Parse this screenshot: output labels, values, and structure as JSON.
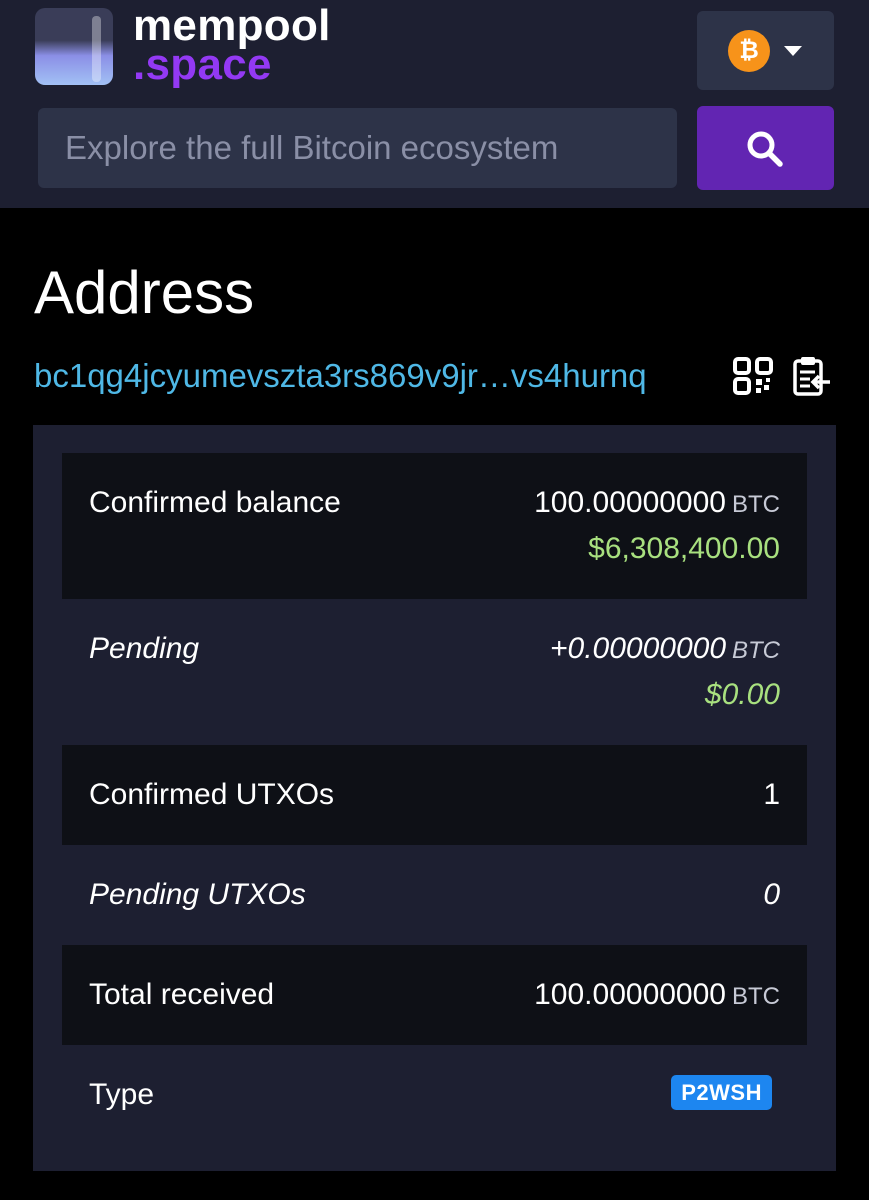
{
  "header": {
    "logo_line1": "mempool",
    "logo_line2": ".space",
    "network_icon": "bitcoin-icon",
    "search_placeholder": "Explore the full Bitcoin ecosystem"
  },
  "page": {
    "title": "Address",
    "address": "bc1qg4jcyumevszta3rs869v9jr…vs4hurnq"
  },
  "details": {
    "confirmed_balance": {
      "label": "Confirmed balance",
      "amount": "100.00000000",
      "unit": "BTC",
      "fiat": "$6,308,400.00"
    },
    "pending": {
      "label": "Pending",
      "amount": "+0.00000000",
      "unit": "BTC",
      "fiat": "$0.00"
    },
    "confirmed_utxos": {
      "label": "Confirmed UTXOs",
      "value": "1"
    },
    "pending_utxos": {
      "label": "Pending UTXOs",
      "value": "0"
    },
    "total_received": {
      "label": "Total received",
      "amount": "100.00000000",
      "unit": "BTC"
    },
    "type": {
      "label": "Type",
      "value": "P2WSH"
    }
  },
  "colors": {
    "header_bg": "#1d1f31",
    "accent_purple": "#6225b2",
    "link_blue": "#4fb8e6",
    "fiat_green": "#a8e07f",
    "badge_blue": "#1d86f0",
    "bitcoin_orange": "#f7931a"
  }
}
